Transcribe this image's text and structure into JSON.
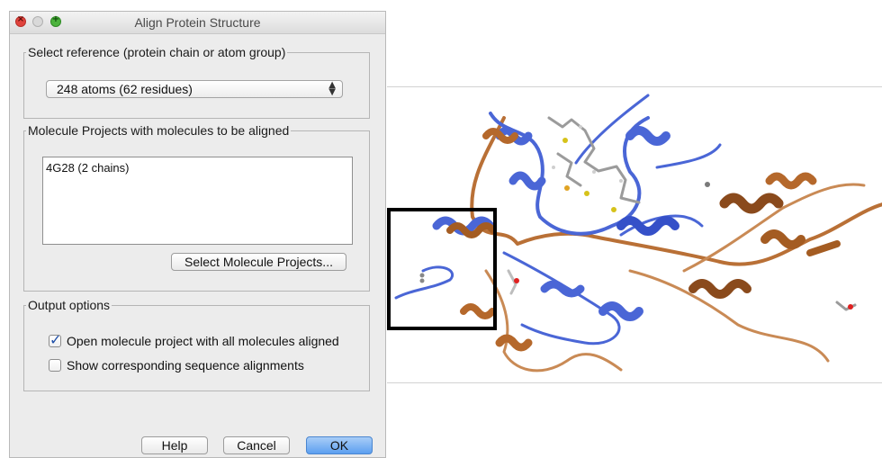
{
  "window": {
    "title": "Align Protein Structure"
  },
  "reference": {
    "legend": "Select reference (protein chain or atom group)",
    "selected": "248 atoms (62 residues)"
  },
  "molecules": {
    "legend": "Molecule Projects with molecules to be aligned",
    "items": [
      "4G28 (2 chains)"
    ],
    "select_button": "Select Molecule Projects..."
  },
  "output": {
    "legend": "Output options",
    "options": [
      {
        "label": "Open molecule project with all molecules aligned",
        "checked": true
      },
      {
        "label": "Show corresponding sequence alignments",
        "checked": false
      }
    ]
  },
  "buttons": {
    "help": "Help",
    "cancel": "Cancel",
    "ok": "OK"
  },
  "colors": {
    "chain_a": "#4a66d6",
    "chain_b": "#b5682b",
    "highlight_box": "#000000"
  }
}
